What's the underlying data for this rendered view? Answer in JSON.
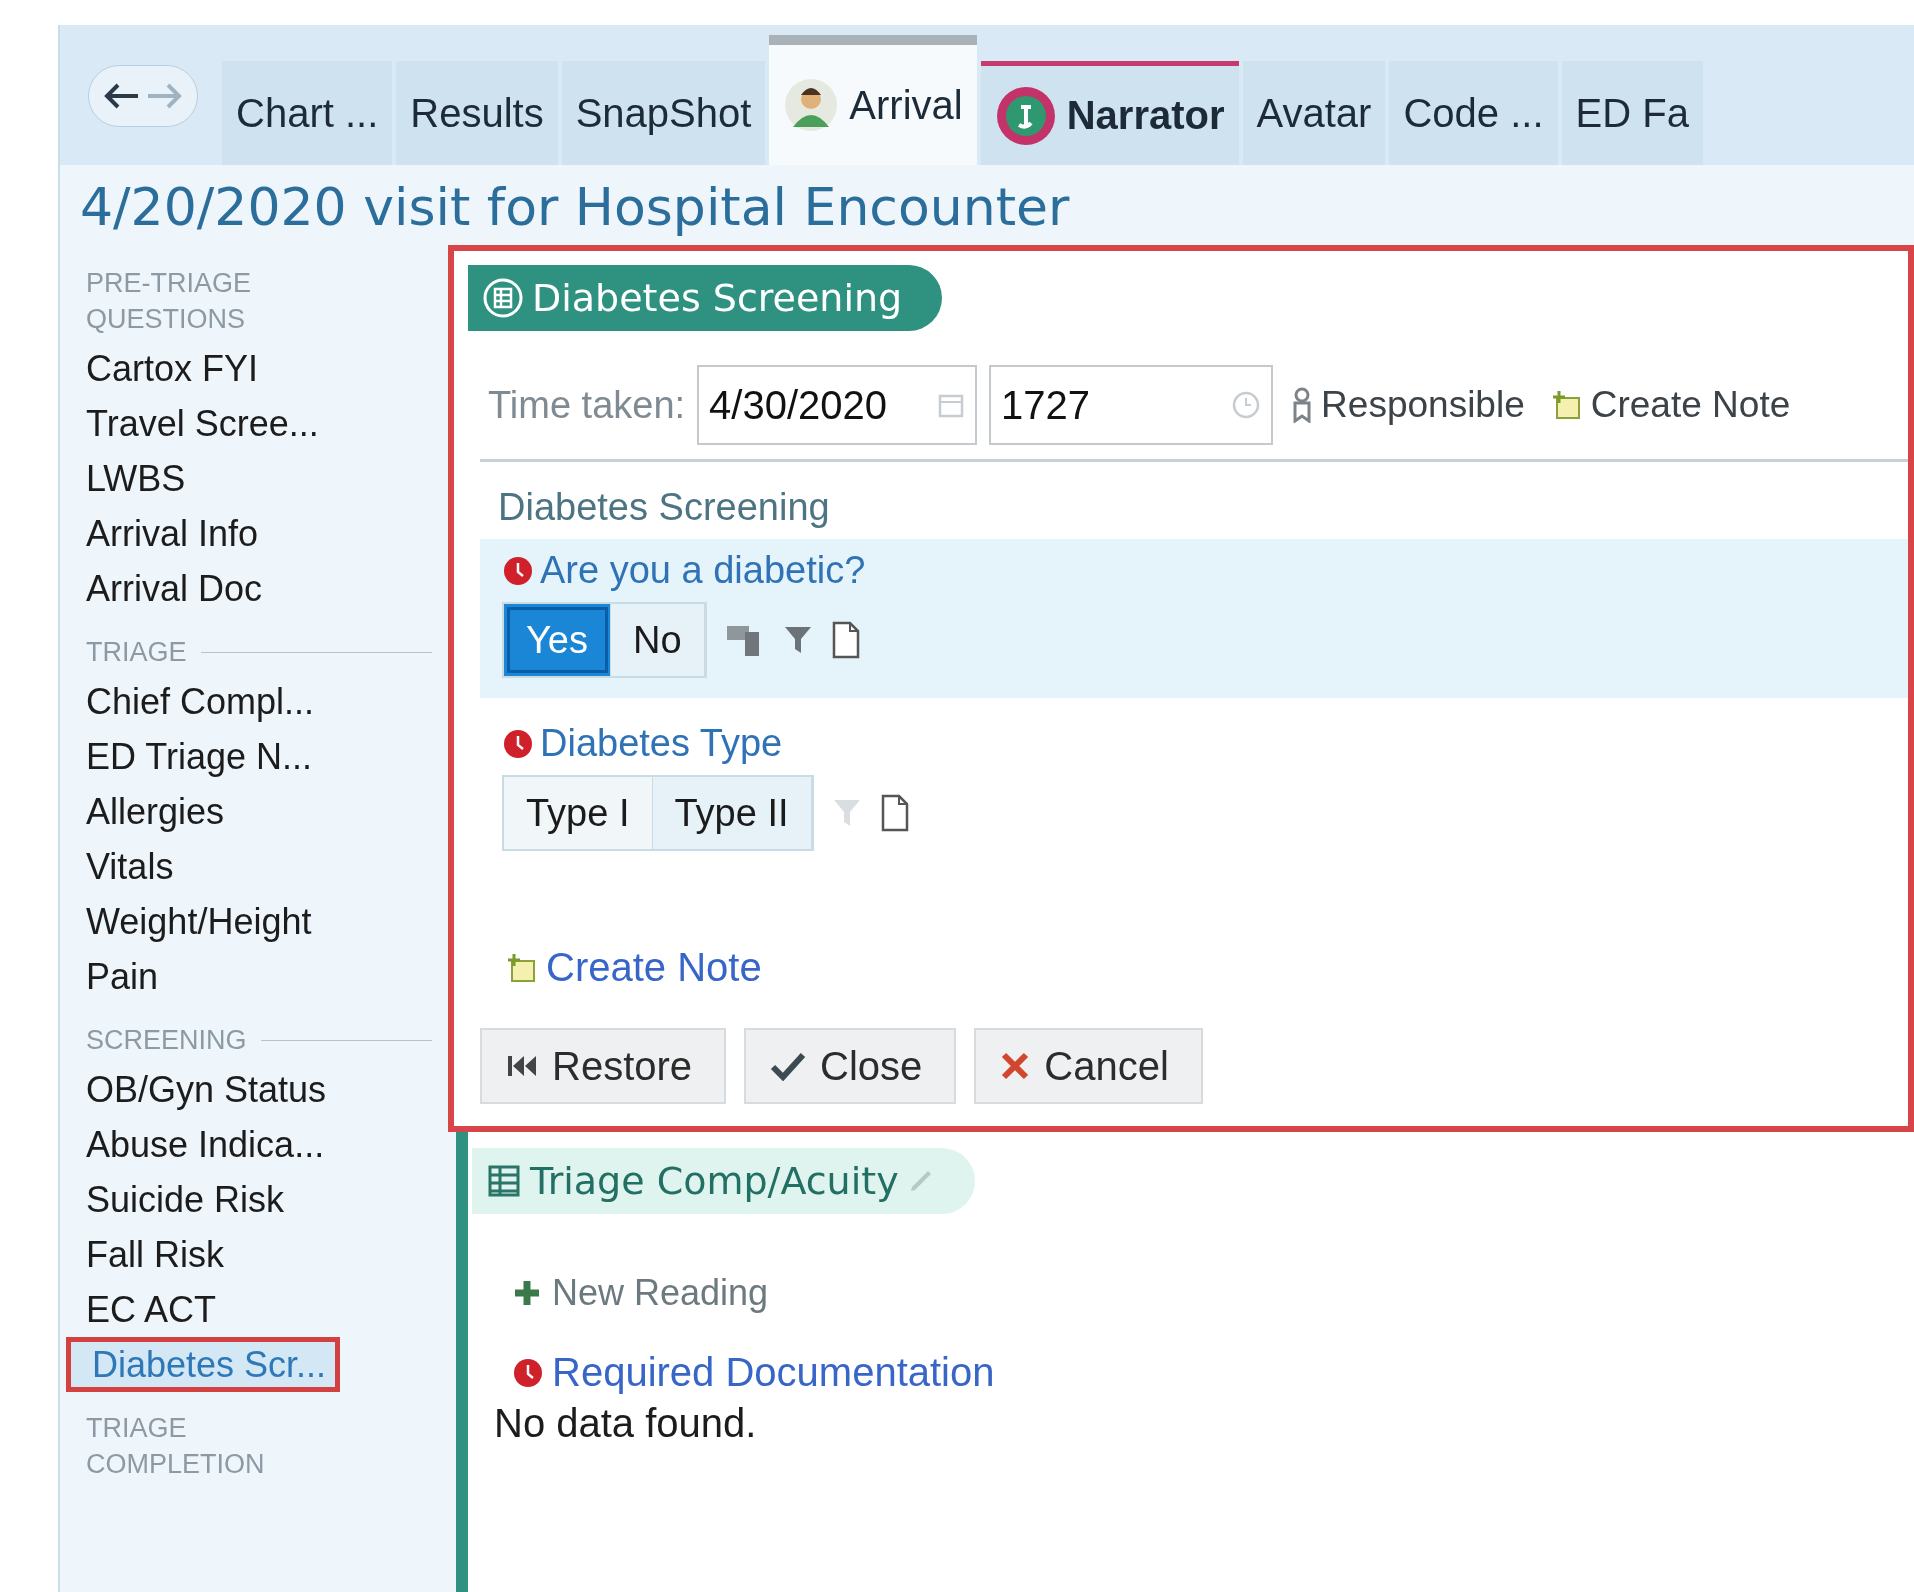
{
  "tabs": [
    {
      "label": "Chart ...",
      "selected": false,
      "kind": "plain"
    },
    {
      "label": "Results",
      "selected": false,
      "kind": "plain"
    },
    {
      "label": "SnapShot",
      "selected": false,
      "kind": "plain"
    },
    {
      "label": "Arrival",
      "selected": true,
      "kind": "person"
    },
    {
      "label": "Narrator",
      "selected": false,
      "kind": "narrator"
    },
    {
      "label": "Avatar",
      "selected": false,
      "kind": "plain"
    },
    {
      "label": "Code ...",
      "selected": false,
      "kind": "plain"
    },
    {
      "label": "ED Fa",
      "selected": false,
      "kind": "plain"
    }
  ],
  "title": "4/20/2020 visit for Hospital Encounter",
  "sidebar": {
    "sections": [
      {
        "title": "PRE-TRIAGE QUESTIONS",
        "items": [
          {
            "label": "Cartox FYI",
            "selected": false
          },
          {
            "label": "Travel Scree...",
            "selected": false
          },
          {
            "label": "LWBS",
            "selected": false
          },
          {
            "label": "Arrival Info",
            "selected": false
          },
          {
            "label": "Arrival Doc",
            "selected": false
          }
        ]
      },
      {
        "title": "TRIAGE",
        "items": [
          {
            "label": "Chief Compl...",
            "selected": false
          },
          {
            "label": "ED Triage N...",
            "selected": false
          },
          {
            "label": "Allergies",
            "selected": false
          },
          {
            "label": "Vitals",
            "selected": false
          },
          {
            "label": "Weight/Height",
            "selected": false
          },
          {
            "label": "Pain",
            "selected": false
          }
        ]
      },
      {
        "title": "SCREENING",
        "items": [
          {
            "label": "OB/Gyn Status",
            "selected": false
          },
          {
            "label": "Abuse Indica...",
            "selected": false
          },
          {
            "label": "Suicide Risk",
            "selected": false
          },
          {
            "label": "Fall Risk",
            "selected": false
          },
          {
            "label": "EC ACT",
            "selected": false
          },
          {
            "label": "Diabetes Scr...",
            "selected": true
          }
        ]
      },
      {
        "title": "TRIAGE COMPLETION"
      }
    ]
  },
  "form": {
    "title": "Diabetes Screening",
    "time_label": "Time taken:",
    "date": "4/30/2020",
    "time": "1727",
    "responsible": "Responsible",
    "create_note": "Create Note",
    "section": "Diabetes Screening",
    "questions": [
      {
        "label": "Are you a diabetic?",
        "highlighted": true,
        "has_comment": true,
        "filter_enabled": true,
        "options": [
          {
            "label": "Yes",
            "selected": true
          },
          {
            "label": "No",
            "selected": false
          }
        ]
      },
      {
        "label": "Diabetes Type",
        "highlighted": false,
        "has_comment": false,
        "filter_enabled": false,
        "options": [
          {
            "label": "Type I",
            "selected": false
          },
          {
            "label": "Type II",
            "selected": false
          }
        ]
      }
    ],
    "note_link": "Create Note",
    "buttons": [
      {
        "label": "Restore",
        "kind": "restore"
      },
      {
        "label": "Close",
        "kind": "close"
      },
      {
        "label": "Cancel",
        "kind": "cancel"
      }
    ]
  },
  "section2": {
    "title": "Triage Comp/Acuity",
    "new_reading": "New Reading",
    "required": "Required Documentation",
    "empty": "No data found."
  }
}
